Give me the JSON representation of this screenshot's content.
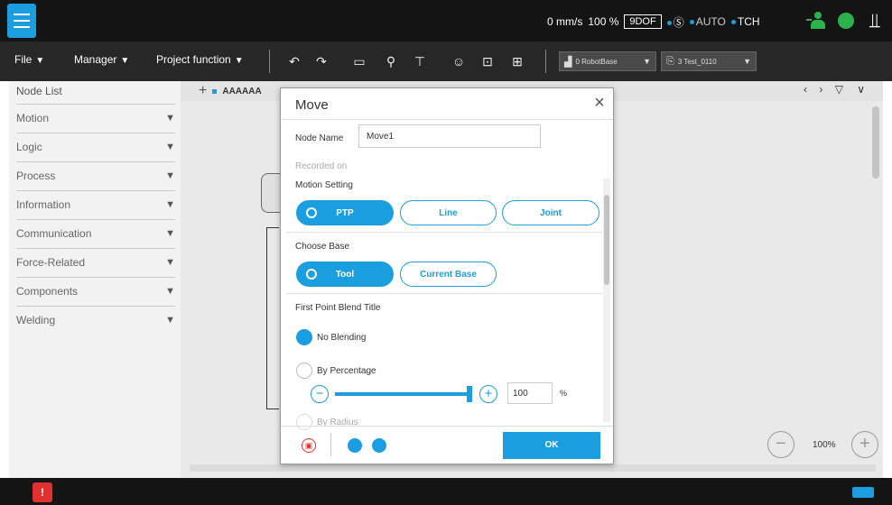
{
  "status": {
    "speed": "0 mm/s",
    "percent": "100 %",
    "dof": "9DOF",
    "mode": "AUTO",
    "tch": "TCH"
  },
  "toolbar": {
    "file": "File",
    "manager": "Manager",
    "project": "Project function",
    "base": "0 RobotBase",
    "tool": "3 Test_0110"
  },
  "sidebar": {
    "title": "Node List",
    "items": [
      "Motion",
      "Logic",
      "Process",
      "Information",
      "Communication",
      "Force-Related",
      "Components",
      "Welding"
    ]
  },
  "canvas": {
    "tab": "AAAAAA",
    "zoom": "100%"
  },
  "dialog": {
    "title": "Move",
    "node_name_label": "Node Name",
    "node_name_value": "Move1",
    "recorded_on": "Recorded on",
    "motion_setting": "Motion Setting",
    "motion_options": [
      "PTP",
      "Line",
      "Joint"
    ],
    "choose_base": "Choose Base",
    "base_options": [
      "Tool",
      "Current Base"
    ],
    "blend_title": "First Point Blend Title",
    "no_blending": "No Blending",
    "by_percentage": "By Percentage",
    "percent_value": "100",
    "percent_unit": "%",
    "percent_level": 1.0,
    "by_radius": "By Radius",
    "ok": "OK"
  },
  "colors": {
    "accent": "#1a9ee0",
    "status_green": "#2bb24c",
    "error": "#e03030"
  }
}
